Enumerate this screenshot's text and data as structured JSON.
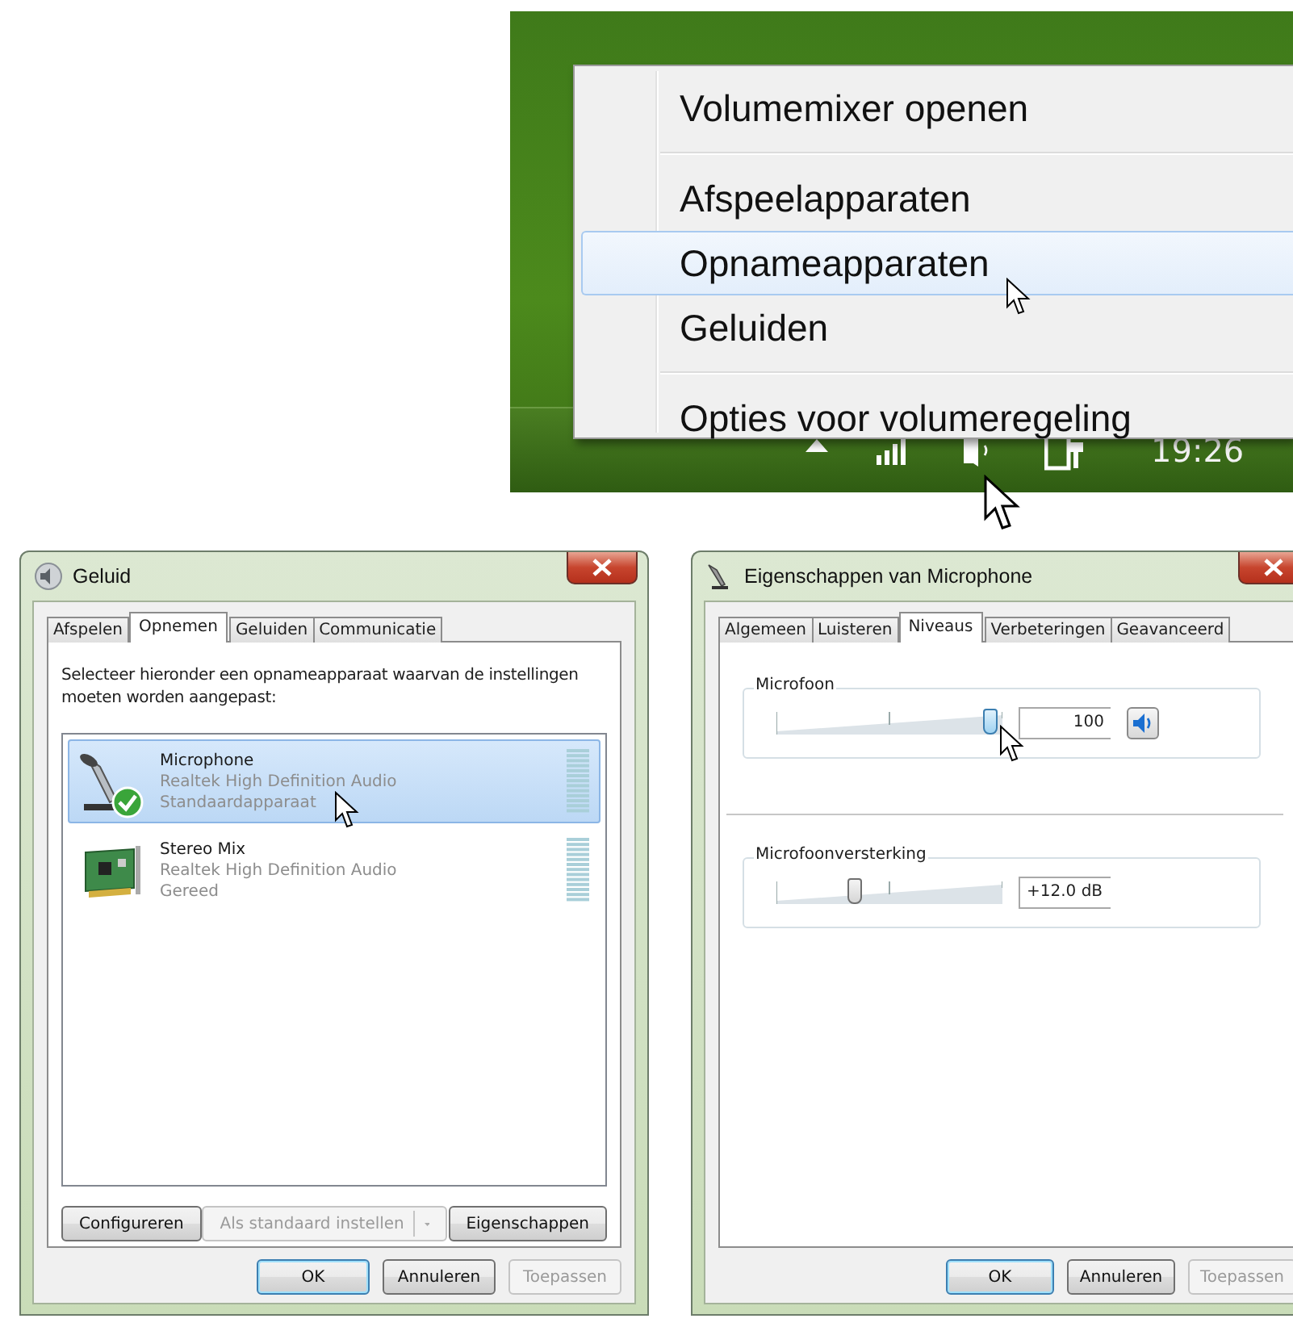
{
  "tray_menu": {
    "groups": [
      {
        "items": [
          {
            "label": "Volumemixer openen",
            "selected": false
          }
        ]
      },
      {
        "items": [
          {
            "label": "Afspeelapparaten",
            "selected": false
          },
          {
            "label": "Opnameapparaten",
            "selected": true
          },
          {
            "label": "Geluiden",
            "selected": false
          }
        ]
      },
      {
        "items": [
          {
            "label": "Opties voor volumeregeling",
            "selected": false
          }
        ]
      }
    ]
  },
  "taskbar": {
    "clock": "19:26"
  },
  "sound_dialog": {
    "title": "Geluid",
    "tabs": [
      {
        "label": "Afspelen",
        "selected": false
      },
      {
        "label": "Opnemen",
        "selected": true
      },
      {
        "label": "Geluiden",
        "selected": false
      },
      {
        "label": "Communicatie",
        "selected": false
      }
    ],
    "instruction": "Selecteer hieronder een opnameapparaat waarvan de instellingen moeten worden aangepast:",
    "devices": [
      {
        "kind": "microphone",
        "name": "Microphone",
        "driver": "Realtek High Definition Audio",
        "status": "Standaardapparaat",
        "default": true,
        "selected": true
      },
      {
        "kind": "soundcard",
        "name": "Stereo Mix",
        "driver": "Realtek High Definition Audio",
        "status": "Gereed",
        "default": false,
        "selected": false
      }
    ],
    "buttons": [
      {
        "kind": "plain",
        "label": "Configureren",
        "disabled": false
      },
      {
        "kind": "split",
        "label": "Als standaard instellen",
        "disabled": true
      },
      {
        "kind": "plain",
        "label": "Eigenschappen",
        "disabled": false
      }
    ],
    "footer_buttons": [
      {
        "label": "OK",
        "default": true,
        "disabled": false
      },
      {
        "label": "Annuleren",
        "default": false,
        "disabled": false
      },
      {
        "label": "Toepassen",
        "default": false,
        "disabled": true
      }
    ]
  },
  "properties_dialog": {
    "title": "Eigenschappen van Microphone",
    "tabs": [
      {
        "label": "Algemeen",
        "selected": false
      },
      {
        "label": "Luisteren",
        "selected": false
      },
      {
        "label": "Niveaus",
        "selected": true
      },
      {
        "label": "Verbeteringen",
        "selected": false
      },
      {
        "label": "Geavanceerd",
        "selected": false
      }
    ],
    "levels": [
      {
        "kind": "volume",
        "label": "Microfoon",
        "level": 1.0,
        "reading": "100"
      },
      {
        "kind": "boost",
        "label": "Microfoonversterking",
        "level": 0.34,
        "reading": "+12.0 dB"
      }
    ],
    "footer_buttons": [
      {
        "label": "OK",
        "default": true,
        "disabled": false
      },
      {
        "label": "Annuleren",
        "default": false,
        "disabled": false
      },
      {
        "label": "Toepassen",
        "default": false,
        "disabled": true
      }
    ]
  }
}
